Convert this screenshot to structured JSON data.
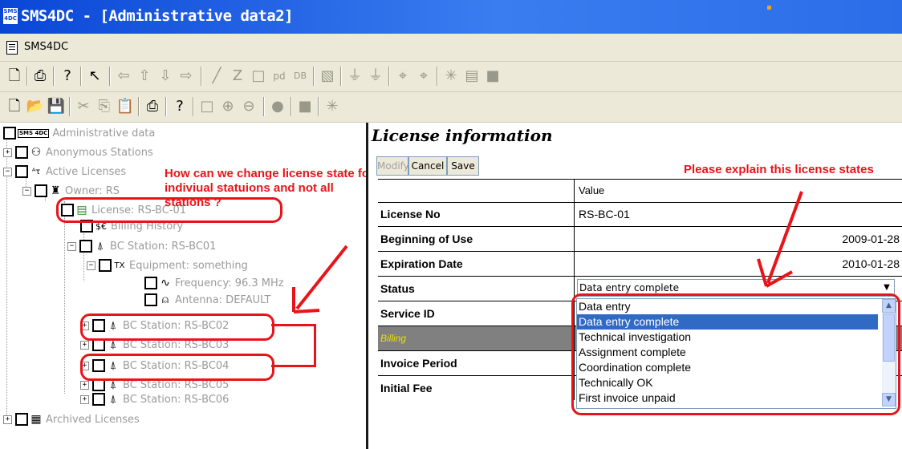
{
  "window": {
    "title": "SMS4DC - [Administrative data2]",
    "app_icon_text": "SMS 4DC"
  },
  "menu": {
    "label": "SMS4DC"
  },
  "toolbar1": {
    "icons": [
      "new-icon",
      "print-icon",
      "help-icon",
      "pointer-icon",
      "arrow-left-icon",
      "arrow-up-icon",
      "arrow-down-icon",
      "arrow-right-icon",
      "line-icon",
      "polyline-icon",
      "rectangle-icon",
      "pdf-icon",
      "db-icon",
      "image-icon",
      "station-icon",
      "station2-icon",
      "mast-icon",
      "mast2-icon",
      "star-icon",
      "grid-icon",
      "square-icon"
    ]
  },
  "toolbar2": {
    "icons": [
      "new-icon",
      "open-icon",
      "save-icon",
      "cut-icon",
      "copy-icon",
      "paste-icon",
      "print-icon",
      "help-icon",
      "rectangle-icon",
      "zoom-in-icon",
      "zoom-out-icon",
      "circle-icon",
      "square-icon",
      "star-icon"
    ]
  },
  "tree": {
    "nodes": [
      {
        "label": "Administrative data",
        "icon": "SMS 4DC"
      },
      {
        "label": "Anonymous Stations",
        "icon": "people-icon"
      },
      {
        "label": "Active Licenses",
        "icon": "license-icon"
      },
      {
        "label": "Owner: RS",
        "icon": "owner-icon"
      },
      {
        "label": "License: RS-BC-01",
        "icon": "document-icon"
      },
      {
        "label": "Billing History",
        "icon": "billing-icon"
      },
      {
        "label": "BC Station: RS-BC01",
        "icon": "tower-icon"
      },
      {
        "label": "Equipment: something",
        "icon": "equipment-icon"
      },
      {
        "label": "Frequency: 96.3 MHz",
        "icon": "wave-icon"
      },
      {
        "label": "Antenna: DEFAULT",
        "icon": "antenna-icon"
      },
      {
        "label": "BC Station: RS-BC02",
        "icon": "tower-icon"
      },
      {
        "label": "BC Station: RS-BC03",
        "icon": "tower-icon"
      },
      {
        "label": "BC Station: RS-BC04",
        "icon": "tower-icon"
      },
      {
        "label": "BC Station: RS-BC05",
        "icon": "tower-icon"
      },
      {
        "label": "BC Station: RS-BC06",
        "icon": "tower-icon"
      },
      {
        "label": "Archived Licenses",
        "icon": "archive-icon"
      }
    ]
  },
  "annotations": {
    "left": "How can we change license state for indiviual statuions and not all stations ?",
    "right": "Please explain this license states",
    "color": "#e8141a"
  },
  "panel": {
    "title": "License information",
    "buttons": {
      "modify": "Modify",
      "cancel": "Cancel",
      "save": "Save"
    },
    "header_value": "Value",
    "rows": [
      {
        "label": "License No",
        "value": "RS-BC-01"
      },
      {
        "label": "Beginning of Use",
        "value": "2009-01-28"
      },
      {
        "label": "Expiration Date",
        "value": "2010-01-28"
      },
      {
        "label": "Status",
        "value": "Data entry complete"
      },
      {
        "label": "Service ID",
        "value": ""
      },
      {
        "label": "Billing",
        "value": ""
      },
      {
        "label": "Invoice Period",
        "value": ""
      },
      {
        "label": "Initial Fee",
        "value": ""
      }
    ],
    "status_options": [
      "Data entry",
      "Data entry complete",
      "Technical investigation",
      "Assignment complete",
      "Coordination complete",
      "Technically OK",
      "First invoice unpaid"
    ],
    "selected_option": "Data entry complete"
  }
}
